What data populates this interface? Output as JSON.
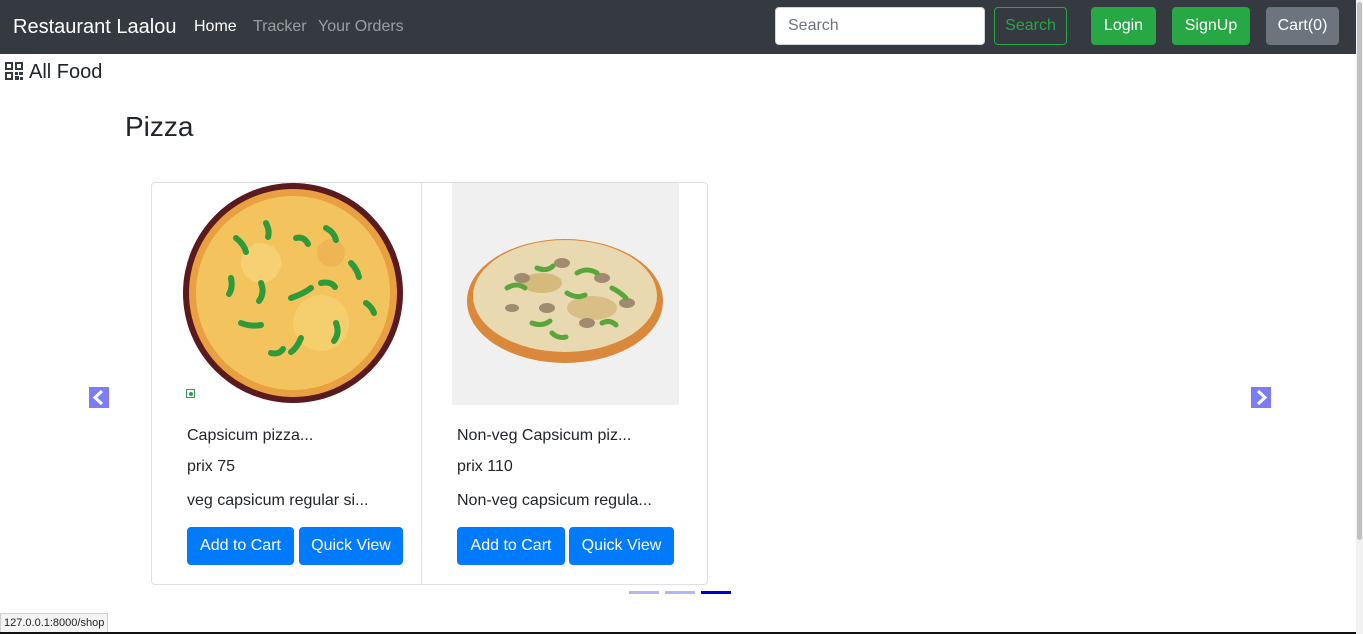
{
  "navbar": {
    "brand": "Restaurant Laalou",
    "links": [
      {
        "label": "Home"
      },
      {
        "label": "Tracker"
      },
      {
        "label": "Your Orders"
      }
    ],
    "search_placeholder": "Search",
    "search_button": "Search",
    "login_button": "Login",
    "signup_button": "SignUp",
    "cart_button": "Cart(0)"
  },
  "all_food": {
    "label": "All Food",
    "icon": "qr-grid-icon"
  },
  "category": {
    "title": "Pizza"
  },
  "products": [
    {
      "title": "Capsicum pizza...",
      "price": "prix 75",
      "description": "veg capsicum regular si...",
      "add_label": "Add to Cart",
      "view_label": "Quick View",
      "veg": true
    },
    {
      "title": "Non-veg Capsicum piz...",
      "price": "prix 110",
      "description": "Non-veg capsicum regula...",
      "add_label": "Add to Cart",
      "view_label": "Quick View",
      "veg": false
    }
  ],
  "carousel": {
    "indicator_count": 3,
    "active_indicator": 3
  },
  "status_bar": {
    "url": "127.0.0.1:8000/shop"
  },
  "colors": {
    "navbar_bg": "#343a40",
    "success": "#28a745",
    "primary": "#007bff",
    "secondary": "#6c757d",
    "carousel_control": "#7c7cf5"
  }
}
